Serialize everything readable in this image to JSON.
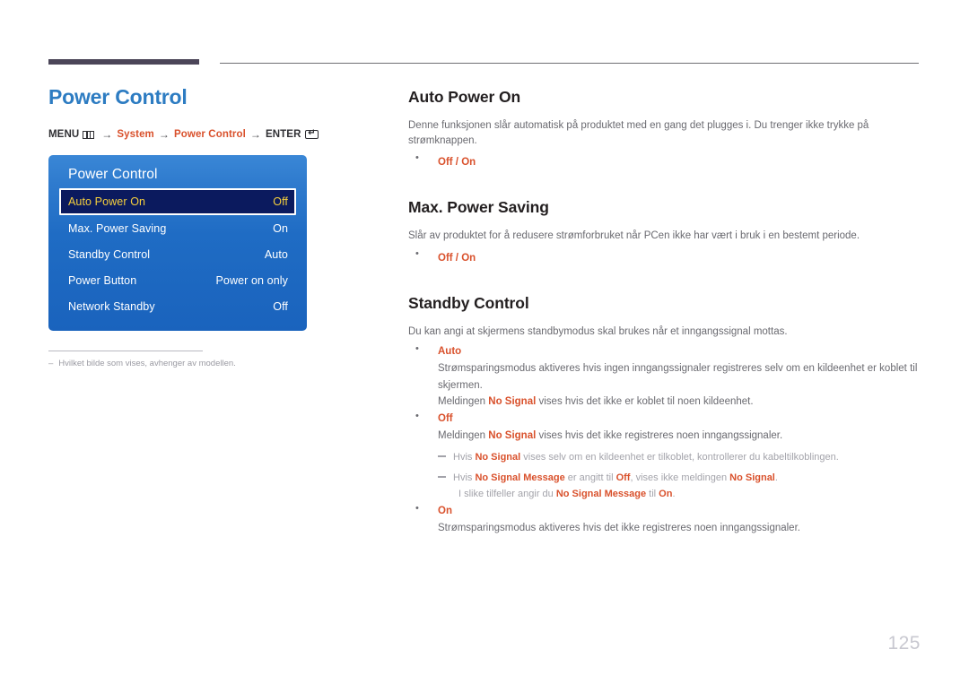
{
  "header": {
    "rule_accent_color": "#4b4558"
  },
  "left": {
    "page_title": "Power Control",
    "breadcrumb": {
      "menu_label": "MENU",
      "menu_icon": "menu-grid-icon",
      "arrow": "→",
      "item1": "System",
      "item2": "Power Control",
      "enter_label": "ENTER",
      "enter_icon": "enter-key-icon",
      "enter_glyph": "↵"
    },
    "osd": {
      "title": "Power Control",
      "rows": [
        {
          "label": "Auto Power On",
          "value": "Off",
          "selected": true
        },
        {
          "label": "Max. Power Saving",
          "value": "On",
          "selected": false
        },
        {
          "label": "Standby Control",
          "value": "Auto",
          "selected": false
        },
        {
          "label": "Power Button",
          "value": "Power on only",
          "selected": false
        },
        {
          "label": "Network Standby",
          "value": "Off",
          "selected": false
        }
      ],
      "highlight_bg": "#0b1a5e",
      "highlight_text": "#f5cf3d"
    },
    "footnote": {
      "dash": "–",
      "text": "Hvilket bilde som vises, avhenger av modellen."
    }
  },
  "right": {
    "sections": [
      {
        "heading": "Auto Power On",
        "paragraph": "Denne funksjonen slår automatisk på produktet med en gang det plugges i. Du trenger ikke trykke på strømknappen.",
        "option_off": "Off",
        "option_sep": " / ",
        "option_on": "On"
      },
      {
        "heading": "Max. Power Saving",
        "paragraph": "Slår av produktet for å redusere strømforbruket når PCen ikke har vært i bruk i en bestemt periode.",
        "option_off": "Off",
        "option_sep": " / ",
        "option_on": "On"
      }
    ],
    "standby": {
      "heading": "Standby Control",
      "paragraph": "Du kan angi at skjermens standbymodus skal brukes når et inngangssignal mottas.",
      "auto": {
        "label": "Auto",
        "line1": "Strømsparingsmodus aktiveres hvis ingen inngangssignaler registreres selv om en kildeenhet er koblet til skjermen.",
        "line2_a": "Meldingen ",
        "line2_b": "No Signal",
        "line2_c": " vises hvis det ikke er koblet til noen kildeenhet."
      },
      "off": {
        "label": "Off",
        "line1_a": "Meldingen ",
        "line1_b": "No Signal",
        "line1_c": " vises hvis det ikke registreres noen inngangssignaler.",
        "note1_a": "Hvis ",
        "note1_b": "No Signal",
        "note1_c": " vises selv om en kildeenhet er tilkoblet, kontrollerer du kabeltilkoblingen.",
        "note2_a": "Hvis ",
        "note2_b": "No Signal Message",
        "note2_c": " er angitt til ",
        "note2_d": "Off",
        "note2_e": ", vises ikke meldingen ",
        "note2_f": "No Signal",
        "note2_g": ".",
        "note2_h": "I slike tilfeller angir du ",
        "note2_i": "No Signal Message",
        "note2_j": " til ",
        "note2_k": "On",
        "note2_l": "."
      },
      "on": {
        "label": "On",
        "line1": "Strømsparingsmodus aktiveres hvis det ikke registreres noen inngangssignaler."
      }
    }
  },
  "footer": {
    "page_number": "125"
  }
}
